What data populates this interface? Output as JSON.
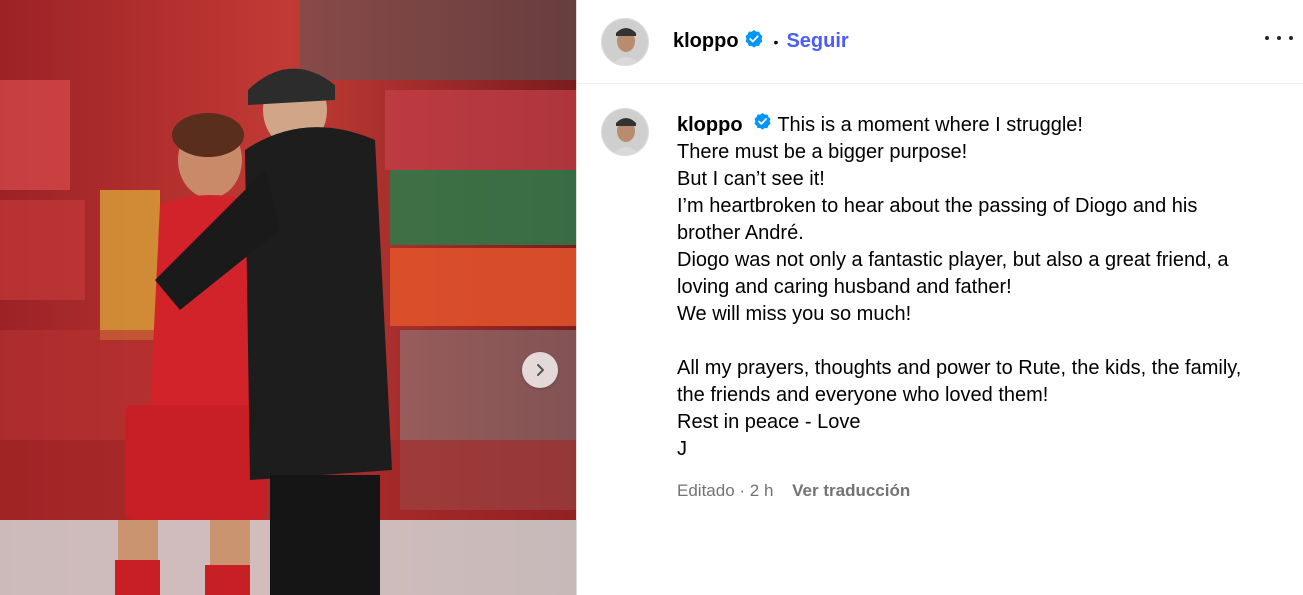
{
  "post": {
    "username": "kloppo",
    "dot": "•",
    "follow_label": "Seguir",
    "caption_first": "This is a moment where I struggle!",
    "caption_lines": [
      "There must be a bigger purpose!",
      "But I can’t see it!",
      "I’m heartbroken to hear about the passing of Diogo and his",
      "brother André.",
      "Diogo was not only a fantastic player, but also a great friend, a",
      "loving and caring husband and father!",
      "We will miss you so much!"
    ],
    "caption_lines_2": [
      "All my prayers, thoughts and power to Rute, the kids, the family,",
      "the friends and everyone who loved them!",
      "Rest in peace - Love",
      "J"
    ],
    "meta": "Editado · 2 h",
    "translate_label": "Ver traducción"
  },
  "icons": {
    "verified": "verified-badge-icon",
    "more": "more-options-icon",
    "next": "chevron-right-icon"
  },
  "colors": {
    "follow": "#4a5df9",
    "verified": "#0095f6",
    "meta": "#737373"
  }
}
